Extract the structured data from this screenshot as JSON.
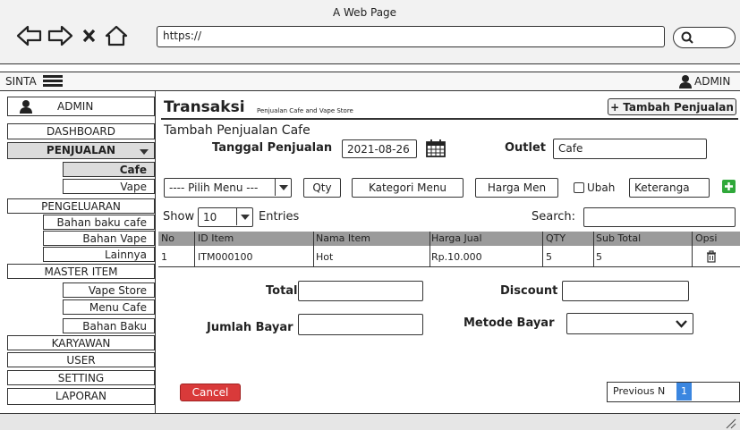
{
  "browser": {
    "title": "A Web Page",
    "url": "https://"
  },
  "navbar": {
    "brand": "SINTA",
    "user": "ADMIN"
  },
  "sidebar": {
    "user": "ADMIN",
    "items": {
      "dashboard": "DASHBOARD",
      "penjualan": "PENJUALAN",
      "cafe": "Cafe",
      "vape": "Vape",
      "pengeluaran": "PENGELUARAN",
      "bahan_baku_cafe": "Bahan baku cafe",
      "bahan_vape": "Bahan Vape",
      "lainnya": "Lainnya",
      "master_item": "MASTER ITEM",
      "vape_store": "Vape Store",
      "menu_cafe": "Menu Cafe",
      "bahan_baku": "Bahan Baku",
      "karyawan": "KARYAWAN",
      "user": "USER",
      "setting": "SETTING",
      "laporan": "LAPORAN"
    }
  },
  "main": {
    "title": "Transaksi",
    "subtitle": "Penjualan Cafe and Vape Store",
    "add_button": "+ Tambah Penjualan",
    "form_title": "Tambah Penjualan Cafe",
    "tanggal_label": "Tanggal Penjualan",
    "tanggal_value": "2021-08-26",
    "outlet_label": "Outlet",
    "outlet_value": "Cafe",
    "pilih_menu": "---- Pilih Menu ---",
    "qty": "Qty",
    "kategori": "Kategori Menu",
    "harga": "Harga Men",
    "ubah": "Ubah",
    "keterangan": "Keteranga",
    "show": "Show",
    "show_value": "10",
    "entries": "Entries",
    "search": "Search:",
    "columns": [
      "No",
      "ID Item",
      "Nama Item",
      "Harga Jual",
      "QTY",
      "Sub Total",
      "Opsi"
    ],
    "rows": [
      [
        "1",
        "ITM000100",
        "Hot",
        "Rp.10.000",
        "5",
        "5"
      ]
    ],
    "total_label": "Total",
    "discount_label": "Discount",
    "jumlah_label": "Jumlah Bayar",
    "metode_label": "Metode Bayar",
    "cancel": "Cancel",
    "previous": "Previous N",
    "page": "1"
  }
}
